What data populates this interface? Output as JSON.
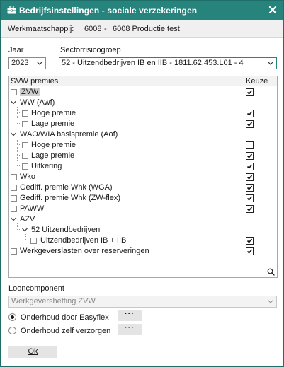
{
  "window": {
    "title": "Bedrijfsinstellingen - sociale verzekeringen",
    "close_icon": "close-icon",
    "title_icon": "briefcase-icon"
  },
  "subheader": {
    "label": "Werkmaatschappij:",
    "code": "6008",
    "separator": "-",
    "name": "6008 Productie test"
  },
  "jaar": {
    "label": "Jaar",
    "value": "2023"
  },
  "sectorrisicogroep": {
    "label": "Sectorrisicogroep",
    "value": "52 - Uitzendbedrijven IB en IIB - 1811.62.453.L01 - 4"
  },
  "tree": {
    "header_premies": "SVW premies",
    "header_keuze": "Keuze",
    "rows": [
      {
        "label": "ZVW",
        "checked": true
      },
      {
        "label": "WW (Awf)",
        "checked": null
      },
      {
        "label": "Hoge premie",
        "checked": true
      },
      {
        "label": "Lage premie",
        "checked": true
      },
      {
        "label": "WAO/WIA basispremie (Aof)",
        "checked": null
      },
      {
        "label": "Hoge premie",
        "checked": false
      },
      {
        "label": "Lage premie",
        "checked": true
      },
      {
        "label": "Uitkering",
        "checked": true
      },
      {
        "label": "Wko",
        "checked": true
      },
      {
        "label": "Gediff. premie Whk (WGA)",
        "checked": true
      },
      {
        "label": "Gediff. premie Whk (ZW-flex)",
        "checked": true
      },
      {
        "label": "PAWW",
        "checked": true
      },
      {
        "label": "AZV",
        "checked": null
      },
      {
        "label": "52 Uitzendbedrijven",
        "checked": null
      },
      {
        "label": "Uitzendbedrijven IB + IIB",
        "checked": true
      },
      {
        "label": "Werkgeverslasten over reserveringen",
        "checked": true
      }
    ],
    "search_icon": "search-icon"
  },
  "looncomponent": {
    "label": "Looncomponent",
    "value": "Werkgeversheffing ZVW"
  },
  "onderhoud": {
    "option1": "Onderhoud door Easyflex",
    "option2": "Onderhoud zelf verzorgen",
    "selected": 1,
    "dots_label": "···"
  },
  "ok": {
    "label": "Ok"
  }
}
